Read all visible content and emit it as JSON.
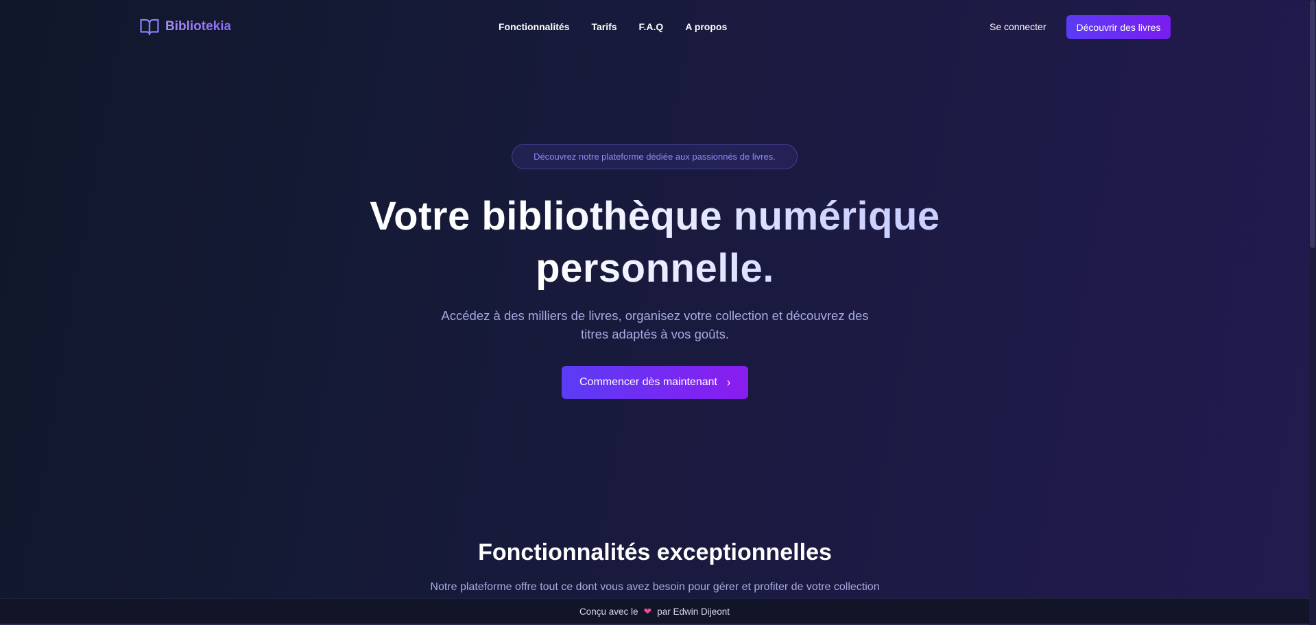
{
  "brand": {
    "name": "Bibliotekia",
    "icon": "book-open-icon"
  },
  "nav": {
    "items": [
      {
        "label": "Fonctionnalités"
      },
      {
        "label": "Tarifs"
      },
      {
        "label": "F.A.Q"
      },
      {
        "label": "A propos"
      }
    ],
    "login_label": "Se connecter",
    "cta_label": "Découvrir des livres"
  },
  "hero": {
    "pill": "Découvrez notre plateforme dédiée aux passionnés de livres.",
    "title_line1": "Votre bibliothèque numérique",
    "title_line2": "personnelle.",
    "subtitle_line1": "Accédez à des milliers de livres, organisez votre collection et découvrez des",
    "subtitle_line2": "titres adaptés à vos goûts.",
    "cta_label": "Commencer dès maintenant",
    "cta_icon": "chevron-right-icon"
  },
  "features": {
    "title": "Fonctionnalités exceptionnelles",
    "subtitle": "Notre plateforme offre tout ce dont vous avez besoin pour gérer et profiter de votre collection"
  },
  "footer": {
    "prefix": "Conçu avec le",
    "icon": "heart-icon",
    "suffix": "par Edwin Dijeont"
  },
  "colors": {
    "accent_start": "#5b3cf5",
    "accent_end": "#8a1cf0",
    "brand": "#a78bfa",
    "heart": "#ec4899"
  }
}
